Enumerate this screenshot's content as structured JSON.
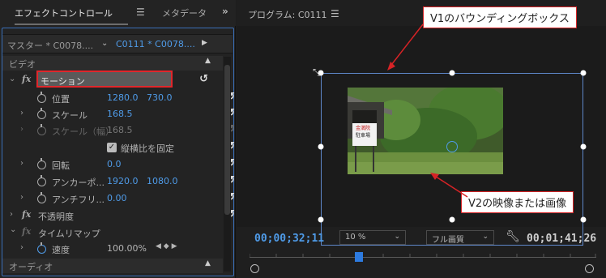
{
  "effect_controls": {
    "tab_label": "エフェクトコントロール",
    "metadata_tab": "メタデータ",
    "source_master": "マスター * C0078....",
    "source_clip": "C0111 * C0078....",
    "section_video": "ビデオ",
    "motion": {
      "label": "モーション",
      "position_label": "位置",
      "position_x": "1280.0",
      "position_y": "730.0",
      "scale_label": "スケール",
      "scale_value": "168.5",
      "scale_width_label": "スケール（幅）",
      "scale_width_value": "168.5",
      "uniform_scale_label": "縦横比を固定",
      "rotation_label": "回転",
      "rotation_value": "0.0",
      "anchor_label": "アンカーポ...",
      "anchor_x": "1920.0",
      "anchor_y": "1080.0",
      "antiflicker_label": "アンチフリ...",
      "antiflicker_value": "0.00"
    },
    "opacity_label": "不透明度",
    "time_remap_label": "タイムリマップ",
    "speed_label": "速度",
    "speed_value": "100.00%",
    "section_audio": "オーディオ"
  },
  "program": {
    "title": "プログラム: C0111",
    "current_timecode": "00;00;32;11",
    "zoom": "10 %",
    "quality": "フル画質",
    "duration_timecode": "00;01;41;26",
    "sign_text": [
      "金満院",
      "駐車場"
    ]
  },
  "callouts": {
    "bbox_label": "V1のバウンディングボックス",
    "video_label": "V2の映像または画像"
  },
  "colors": {
    "accent": "#4f9be8",
    "highlight_border": "#e0262b",
    "callout_border": "#d72326"
  }
}
